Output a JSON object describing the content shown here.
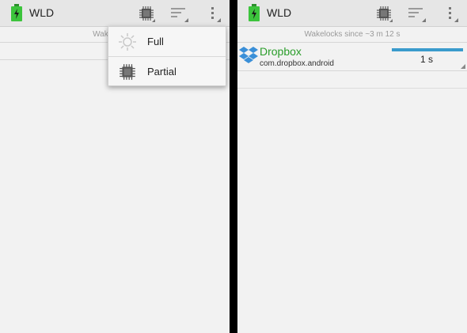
{
  "app": {
    "title": "WLD"
  },
  "left": {
    "subheader": "Wakelocks s",
    "menu": {
      "items": [
        {
          "label": "Full",
          "icon": "sun-icon"
        },
        {
          "label": "Partial",
          "icon": "chip-icon"
        }
      ]
    }
  },
  "right": {
    "subheader": "Wakelocks since ~3 m 12 s",
    "rows": [
      {
        "name": "Dropbox",
        "package": "com.dropbox.android",
        "time": "1 s",
        "progress": 1.0,
        "icon": "dropbox-icon"
      }
    ]
  },
  "colors": {
    "accent_green": "#2a9d2a",
    "bar_blue": "#3a9bcc",
    "battery_green": "#3cc43c"
  }
}
